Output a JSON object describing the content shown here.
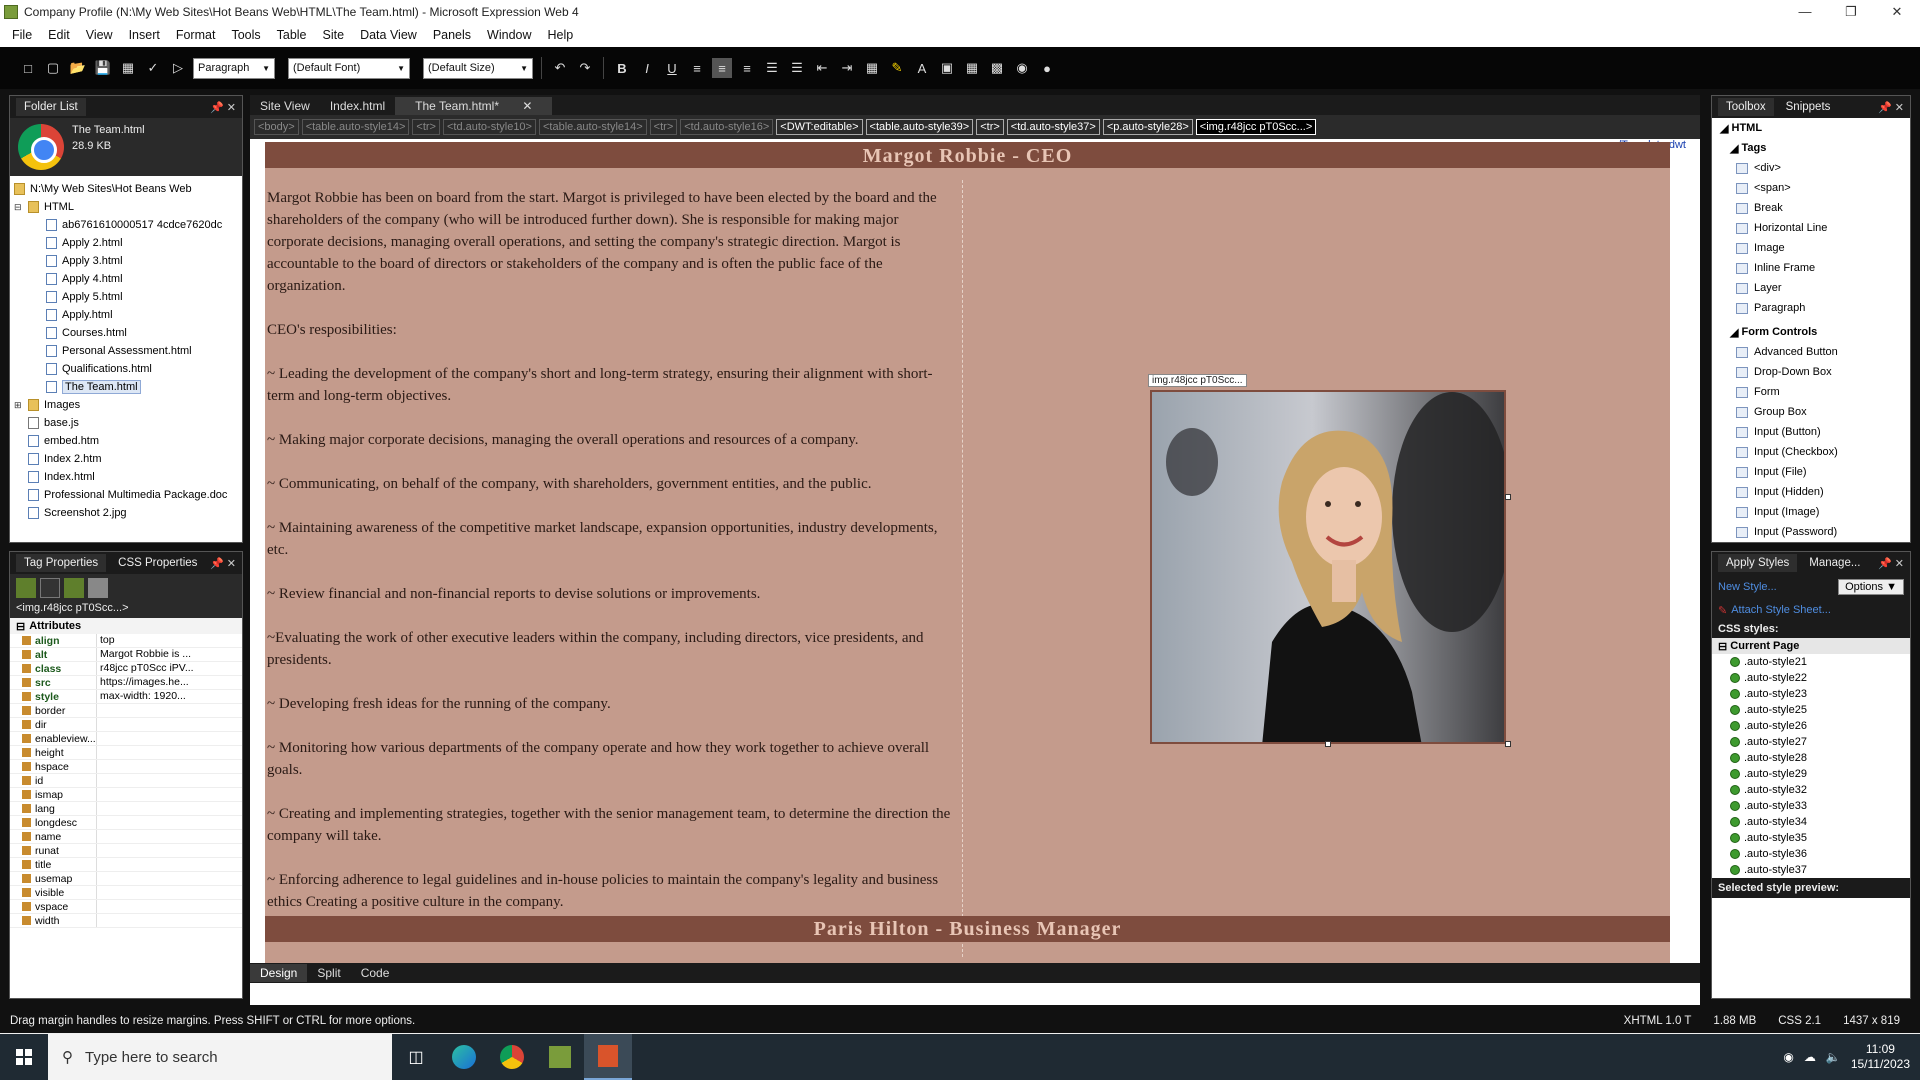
{
  "window": {
    "title": "Company Profile (N:\\My Web Sites\\Hot Beans Web\\HTML\\The Team.html) - Microsoft Expression Web 4"
  },
  "menu": [
    "File",
    "Edit",
    "View",
    "Insert",
    "Format",
    "Tools",
    "Table",
    "Site",
    "Data View",
    "Panels",
    "Window",
    "Help"
  ],
  "toolbar": {
    "style_select": "Paragraph",
    "font_select": "(Default Font)",
    "size_select": "(Default Size)",
    "bold": "B",
    "italic": "I",
    "underline": "U"
  },
  "folder_list": {
    "title": "Folder List",
    "file_name": "The Team.html",
    "file_size": "28.9 KB",
    "root": "N:\\My Web Sites\\Hot Beans Web",
    "html_folder": "HTML",
    "html_files": [
      "ab6761610000517 4cdce7620dc",
      "Apply 2.html",
      "Apply 3.html",
      "Apply 4.html",
      "Apply 5.html",
      "Apply.html",
      "Courses.html",
      "Personal Assessment.html",
      "Qualifications.html",
      "The Team.html"
    ],
    "other_items": [
      {
        "label": "Images",
        "type": "folder"
      },
      {
        "label": "base.js",
        "type": "js"
      },
      {
        "label": "embed.htm",
        "type": "file"
      },
      {
        "label": "Index 2.htm",
        "type": "file"
      },
      {
        "label": "Index.html",
        "type": "file"
      },
      {
        "label": "Professional Multimedia Package.doc",
        "type": "file"
      },
      {
        "label": "Screenshot 2.jpg",
        "type": "file"
      }
    ]
  },
  "tag_properties": {
    "tab1": "Tag Properties",
    "tab2": "CSS Properties",
    "element": "<img.r48jcc pT0Scc...>",
    "section": "Attributes",
    "attributes": [
      {
        "name": "align",
        "value": "top",
        "set": true
      },
      {
        "name": "alt",
        "value": "Margot Robbie is ...",
        "set": true
      },
      {
        "name": "class",
        "value": "r48jcc pT0Scc iPV...",
        "set": true
      },
      {
        "name": "src",
        "value": "https://images.he...",
        "set": true
      },
      {
        "name": "style",
        "value": "max-width: 1920...",
        "set": true
      },
      {
        "name": "border",
        "value": "",
        "set": false
      },
      {
        "name": "dir",
        "value": "",
        "set": false
      },
      {
        "name": "enableview...",
        "value": "",
        "set": false
      },
      {
        "name": "height",
        "value": "",
        "set": false
      },
      {
        "name": "hspace",
        "value": "",
        "set": false
      },
      {
        "name": "id",
        "value": "",
        "set": false
      },
      {
        "name": "ismap",
        "value": "",
        "set": false
      },
      {
        "name": "lang",
        "value": "",
        "set": false
      },
      {
        "name": "longdesc",
        "value": "",
        "set": false
      },
      {
        "name": "name",
        "value": "",
        "set": false
      },
      {
        "name": "runat",
        "value": "",
        "set": false
      },
      {
        "name": "title",
        "value": "",
        "set": false
      },
      {
        "name": "usemap",
        "value": "",
        "set": false
      },
      {
        "name": "visible",
        "value": "",
        "set": false
      },
      {
        "name": "vspace",
        "value": "",
        "set": false
      },
      {
        "name": "width",
        "value": "",
        "set": false
      }
    ]
  },
  "editor": {
    "doc_tabs": [
      "Site View",
      "Index.html",
      "The Team.html*"
    ],
    "breadcrumbs": [
      {
        "label": "<body>",
        "state": "dim"
      },
      {
        "label": "<table.auto-style14>",
        "state": "dim"
      },
      {
        "label": "<tr>",
        "state": "dim"
      },
      {
        "label": "<td.auto-style10>",
        "state": "dim"
      },
      {
        "label": "<table.auto-style14>",
        "state": "dim"
      },
      {
        "label": "<tr>",
        "state": "dim"
      },
      {
        "label": "<td.auto-style16>",
        "state": "dim"
      },
      {
        "label": "<DWT:editable>",
        "state": "on"
      },
      {
        "label": "<table.auto-style39>",
        "state": "on"
      },
      {
        "label": "<tr>",
        "state": "on"
      },
      {
        "label": "<td.auto-style37>",
        "state": "on"
      },
      {
        "label": "<p.auto-style28>",
        "state": "on"
      },
      {
        "label": "<img.r48jcc pT0Scc...>",
        "state": "sel"
      }
    ],
    "template_link": "../Template.dwt",
    "section1_heading": "Margot Robbie - CEO",
    "paragraphs": [
      "Margot Robbie has been on board from the start. Margot is privileged to have been elected by the board and the shareholders of the company (who will be introduced further down). She is responsible for making major corporate decisions, managing overall operations, and setting the company's strategic direction. Margot is accountable to the board of directors or stakeholders of the company and is often the public face of the organization.",
      "CEO's resposibilities:",
      "~ Leading the development of the company's short and long-term strategy, ensuring their alignment with short-term and long-term objectives.",
      "~ Making major corporate decisions, managing the overall operations and resources of a company.",
      "~ Communicating, on behalf of the company, with shareholders, government entities, and the public.",
      "~ Maintaining awareness of the competitive market landscape, expansion opportunities, industry developments, etc.",
      "~ Review financial and non-financial reports to devise solutions or improvements.",
      "~Evaluating the work of other executive leaders within the company, including directors, vice presidents, and presidents.",
      "~ Developing fresh ideas for the running of the company.",
      "~ Monitoring how various departments of the company operate and how they work together to achieve overall goals.",
      "~ Creating and implementing strategies, together with the senior management team, to determine the direction the company will take.",
      "~ Enforcing adherence to legal guidelines and in-house policies to maintain the company's legality and business ethics Creating a positive culture in the company."
    ],
    "image_label": "img.r48jcc pT0Scc...",
    "section2_heading": "Paris Hilton - Business Manager",
    "view_tabs": [
      "Design",
      "Split",
      "Code"
    ]
  },
  "toolbox": {
    "tab1": "Toolbox",
    "tab2": "Snippets",
    "html_label": "HTML",
    "tags_label": "Tags",
    "tags": [
      "<div>",
      "<span>",
      "Break",
      "Horizontal Line",
      "Image",
      "Inline Frame",
      "Layer",
      "Paragraph"
    ],
    "form_label": "Form Controls",
    "form_controls": [
      "Advanced Button",
      "Drop-Down Box",
      "Form",
      "Group Box",
      "Input (Button)",
      "Input (Checkbox)",
      "Input (File)",
      "Input (Hidden)",
      "Input (Image)",
      "Input (Password)"
    ]
  },
  "apply_styles": {
    "tab1": "Apply Styles",
    "tab2": "Manage...",
    "new_style": "New Style...",
    "options": "Options",
    "attach": "Attach Style Sheet...",
    "css_styles_label": "CSS styles:",
    "current_page": "Current Page",
    "styles": [
      ".auto-style21",
      ".auto-style22",
      ".auto-style23",
      ".auto-style25",
      ".auto-style26",
      ".auto-style27",
      ".auto-style28",
      ".auto-style29",
      ".auto-style32",
      ".auto-style33",
      ".auto-style34",
      ".auto-style35",
      ".auto-style36",
      ".auto-style37"
    ],
    "preview_label": "Selected style preview:"
  },
  "status": {
    "message": "Drag margin handles to resize margins. Press SHIFT or CTRL for more options.",
    "doctype": "XHTML 1.0 T",
    "size": "1.88 MB",
    "css": "CSS 2.1",
    "dimensions": "1437 x 819"
  },
  "taskbar": {
    "search_placeholder": "Type here to search",
    "time": "11:09",
    "date": "15/11/2023"
  },
  "colors": {
    "page_bg": "#c49b8c",
    "heading_bg": "#7e4c3e",
    "heading_text": "#e8c5b5"
  }
}
